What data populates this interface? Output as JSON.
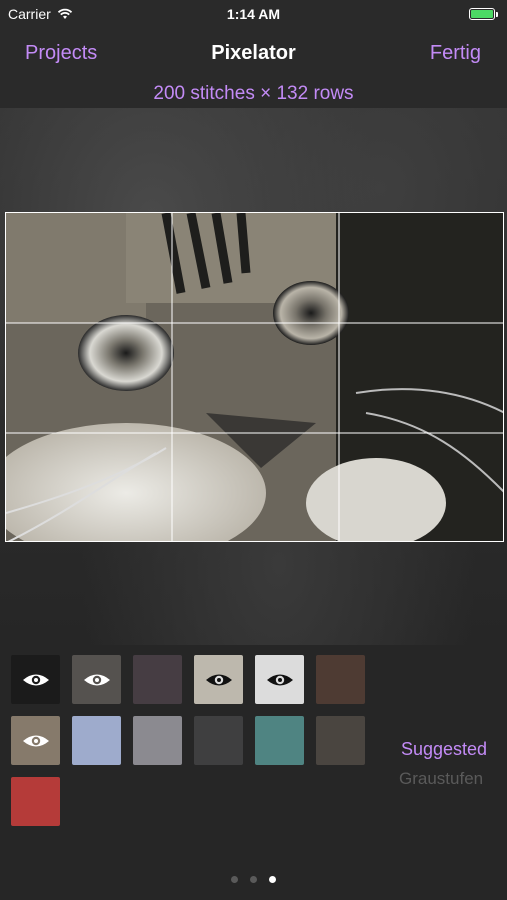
{
  "status": {
    "carrier": "Carrier",
    "time": "1:14 AM"
  },
  "nav": {
    "left": "Projects",
    "title": "Pixelator",
    "right": "Fertig"
  },
  "dimensions_label": "200 stitches × 132 rows",
  "palette": {
    "swatches": [
      {
        "color": "#1b1b1b",
        "visible": true
      },
      {
        "color": "#55524f",
        "visible": true
      },
      {
        "color": "#463d43",
        "visible": false
      },
      {
        "color": "#bdb8ad",
        "visible": true
      },
      {
        "color": "#dcdcdc",
        "visible": true
      },
      {
        "color": "#4e3b33",
        "visible": false
      },
      {
        "color": "#867a6b",
        "visible": true
      },
      {
        "color": "#9eabcc",
        "visible": false
      },
      {
        "color": "#8b8a90",
        "visible": false
      },
      {
        "color": "#3f3f40",
        "visible": false
      },
      {
        "color": "#4f8482",
        "visible": false
      },
      {
        "color": "#4a4540",
        "visible": false
      },
      {
        "color": "#b53b39",
        "visible": false
      }
    ],
    "suggested_label": "Suggested",
    "grayscale_label": "Graustufen"
  },
  "page_dots": {
    "count": 3,
    "active": 3
  },
  "colors": {
    "accent": "#c38bf6",
    "battery": "#4cd964"
  }
}
